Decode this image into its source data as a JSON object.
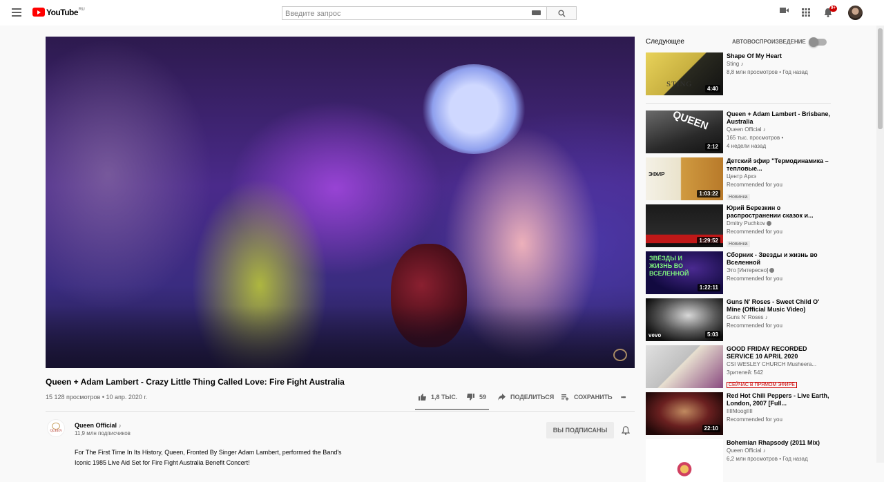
{
  "masthead": {
    "logo_text": "YouTube",
    "logo_region": "RU",
    "search_placeholder": "Введите запрос",
    "notification_count": "9+"
  },
  "video": {
    "title": "Queen + Adam Lambert - Crazy Little Thing Called Love: Fire Fight Australia",
    "views_date": "15 128 просмотров • 10 апр. 2020 г.",
    "likes": "1,8 ТЫС.",
    "dislikes": "59",
    "share_label": "ПОДЕЛИТЬСЯ",
    "save_label": "СОХРАНИТЬ",
    "more_label": "•••"
  },
  "channel": {
    "name": "Queen Official",
    "note": "♪",
    "subscribers": "11,9 млн подписчиков",
    "subscribed_label": "ВЫ ПОДПИСАНЫ",
    "avatar_wordmark": "QUEEN"
  },
  "description": {
    "line1": "For The First Time In Its History, Queen, Fronted By Singer Adam Lambert, performed the Band's",
    "line2": "Iconic 1985 Live Aid Set for Fire Fight Australia Benefit Concert!"
  },
  "sidebar": {
    "up_next": "Следующее",
    "autoplay": "АВТОВОСПРОИЗВЕДЕНИЕ",
    "autoplay_on": false,
    "items": [
      {
        "title": "Shape Of My Heart",
        "channel": "Sting ♪",
        "meta": "8,8 млн просмотров • Год назад",
        "duration": "4:40",
        "tag": "",
        "thumb_text": "STING"
      },
      {
        "title": "Queen + Adam Lambert - Brisbane, Australia",
        "channel": "Queen Official ♪",
        "meta": "165 тыс. просмотров •",
        "meta2": "4 недели назад",
        "duration": "2:12",
        "tag": "",
        "thumb_text": "QUEEN"
      },
      {
        "title": "Детский эфир \"Термодинамика – тепловые...",
        "channel": "Центр Архэ",
        "meta": "Recommended for you",
        "duration": "1:03:22",
        "tag": "Новинка",
        "thumb_text": "ЭФИР"
      },
      {
        "title": "Юрий Березкин о распространении сказок и...",
        "channel": "Dmitry Puchkov",
        "meta": "Recommended for you",
        "duration": "1:29:52",
        "tag": "Новинка",
        "thumb_text": ""
      },
      {
        "title": "Сборник - Звезды и жизнь во Вселенной",
        "channel": "Это [Интересно]",
        "meta": "Recommended for you",
        "duration": "1:22:11",
        "tag": "",
        "thumb_text": "ЗВЁЗДЫ И ЖИЗНЬ ВО ВСЕЛЕННОЙ"
      },
      {
        "title": "Guns N' Roses - Sweet Child O' Mine (Official Music Video)",
        "channel": "Guns N' Roses ♪",
        "meta": "Recommended for you",
        "duration": "5:03",
        "tag": "",
        "thumb_text": "vevo"
      },
      {
        "title": "GOOD FRIDAY RECORDED SERVICE 10 APRIL 2020",
        "channel": "CSI WESLEY CHURCH Musheera...",
        "meta": "Зрителей: 542",
        "duration": "",
        "tag": "",
        "live": "СЕЙЧАС В ПРЯМОМ ЭФИРЕ",
        "thumb_text": ""
      },
      {
        "title": "Red Hot Chili Peppers - Live Earth, London, 2007 [Full...",
        "channel": "IIIIMoogIIII",
        "meta": "Recommended for you",
        "duration": "22:10",
        "tag": "",
        "thumb_text": ""
      },
      {
        "title": "Bohemian Rhapsody (2011 Mix)",
        "channel": "Queen Official ♪",
        "meta": "6,2 млн просмотров • Год назад",
        "duration": "",
        "tag": "",
        "thumb_text": ""
      }
    ]
  },
  "colors": {
    "brand_red": "#ff0000",
    "live_red": "#cc0000",
    "text_secondary": "#606060"
  }
}
